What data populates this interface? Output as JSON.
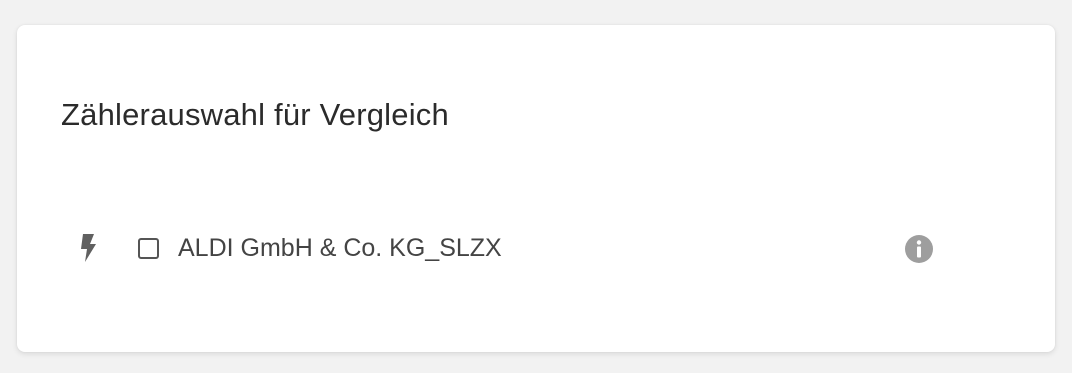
{
  "card": {
    "title": "Zählerauswahl für Vergleich"
  },
  "meters": [
    {
      "label": "ALDI GmbH & Co. KG_SLZX",
      "type_icon": "lightning-bolt-icon",
      "checked": false,
      "info_icon": "info-icon"
    }
  ],
  "colors": {
    "background": "#f2f2f2",
    "card": "#ffffff",
    "title_text": "#2b2b2b",
    "label_text": "#444444",
    "icon_gray": "#606060",
    "info_icon_gray": "#9e9e9e"
  }
}
